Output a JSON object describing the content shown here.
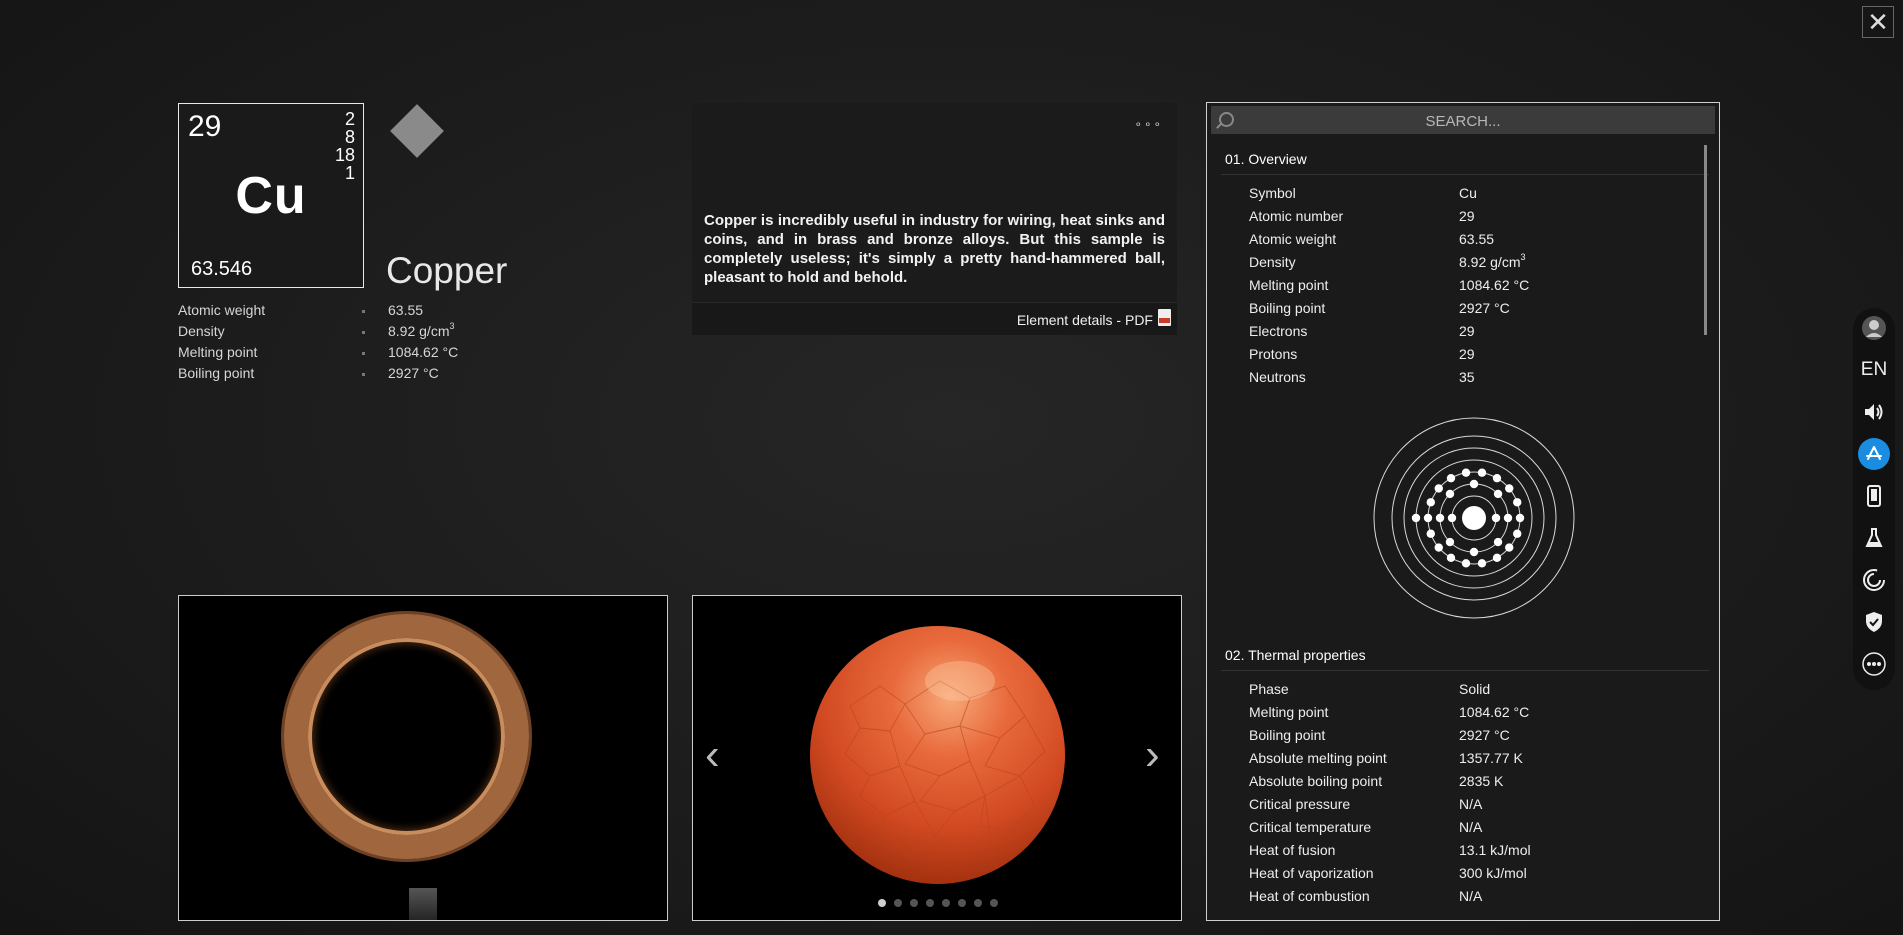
{
  "close_label": "✕",
  "element": {
    "number": "29",
    "shells": [
      "2",
      "8",
      "18",
      "1"
    ],
    "symbol": "Cu",
    "weight": "63.546",
    "name": "Copper"
  },
  "summary": [
    {
      "label": "Atomic weight",
      "value": "63.55"
    },
    {
      "label": "Density",
      "value": "8.92 g/cm",
      "sup": "3"
    },
    {
      "label": "Melting point",
      "value": "1084.62 °C"
    },
    {
      "label": "Boiling point",
      "value": "2927 °C"
    }
  ],
  "description": {
    "menu": "∘∘∘",
    "text": "Copper is incredibly useful in industry for wiring, heat sinks and coins, and in brass and bronze alloys. But this sample is completely useless; it's simply a pretty hand-hammered ball, pleasant to hold and behold.",
    "pdf_label": "Element details - PDF"
  },
  "gallery": {
    "prev": "‹",
    "next": "›",
    "pages": 8,
    "active_page": 1
  },
  "panel": {
    "search_placeholder": "SEARCH...",
    "sections": [
      {
        "title": "01. Overview",
        "rows": [
          {
            "label": "Symbol",
            "value": "Cu"
          },
          {
            "label": "Atomic number",
            "value": "29"
          },
          {
            "label": "Atomic weight",
            "value": "63.55"
          },
          {
            "label": "Density",
            "value": "8.92 g/cm",
            "sup": "3"
          },
          {
            "label": "Melting point",
            "value": "1084.62 °C"
          },
          {
            "label": "Boiling point",
            "value": "2927 °C"
          },
          {
            "label": "Electrons",
            "value": "29"
          },
          {
            "label": "Protons",
            "value": "29"
          },
          {
            "label": "Neutrons",
            "value": "35"
          }
        ]
      },
      {
        "title": "02. Thermal properties",
        "rows": [
          {
            "label": "Phase",
            "value": "Solid"
          },
          {
            "label": "Melting point",
            "value": "1084.62 °C"
          },
          {
            "label": "Boiling point",
            "value": "2927 °C"
          },
          {
            "label": "Absolute melting point",
            "value": "1357.77 K"
          },
          {
            "label": "Absolute boiling point",
            "value": "2835 K"
          },
          {
            "label": "Critical pressure",
            "value": "N/A"
          },
          {
            "label": "Critical temperature",
            "value": "N/A"
          },
          {
            "label": "Heat of fusion",
            "value": "13.1 kJ/mol"
          },
          {
            "label": "Heat of vaporization",
            "value": "300 kJ/mol"
          },
          {
            "label": "Heat of combustion",
            "value": "N/A"
          }
        ]
      }
    ]
  },
  "sidebar": {
    "lang": "EN",
    "items": [
      "avatar-icon",
      "language-button",
      "speaker-icon",
      "app-store-icon",
      "phone-icon",
      "flask-icon",
      "spiral-icon",
      "shield-check-icon",
      "more-icon"
    ],
    "accent": "#1a8de0"
  }
}
